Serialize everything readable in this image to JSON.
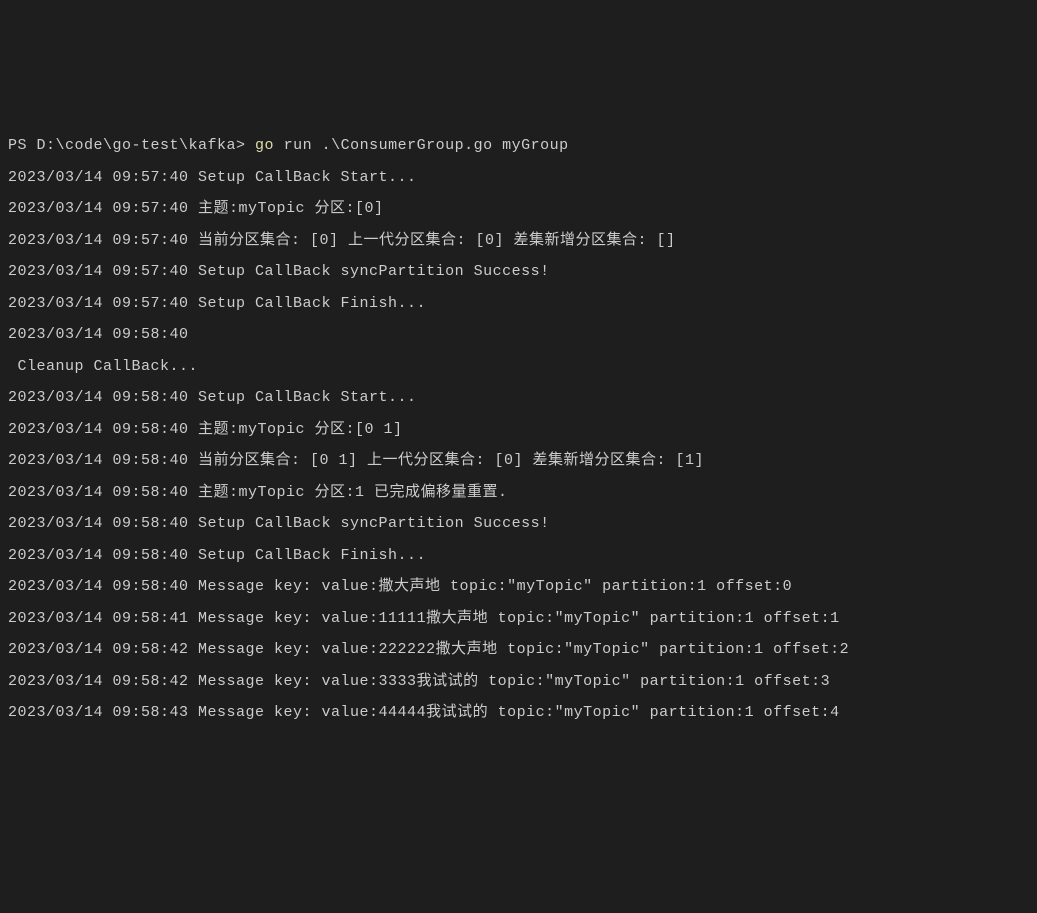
{
  "prompt": {
    "prefix": "PS D:\\code\\go-test\\kafka> ",
    "command": "go",
    "args": " run .\\ConsumerGroup.go myGroup"
  },
  "logs": [
    "2023/03/14 09:57:40 Setup CallBack Start...",
    "2023/03/14 09:57:40 主题:myTopic 分区:[0]",
    "2023/03/14 09:57:40 当前分区集合: [0] 上一代分区集合: [0] 差集新增分区集合: []",
    "2023/03/14 09:57:40 Setup CallBack syncPartition Success!",
    "2023/03/14 09:57:40 Setup CallBack Finish...",
    "2023/03/14 09:58:40",
    " Cleanup CallBack...",
    "2023/03/14 09:58:40 Setup CallBack Start...",
    "2023/03/14 09:58:40 主题:myTopic 分区:[0 1]",
    "2023/03/14 09:58:40 当前分区集合: [0 1] 上一代分区集合: [0] 差集新增分区集合: [1]",
    "2023/03/14 09:58:40 主题:myTopic 分区:1 已完成偏移量重置.",
    "2023/03/14 09:58:40 Setup CallBack syncPartition Success!",
    "2023/03/14 09:58:40 Setup CallBack Finish...",
    "2023/03/14 09:58:40 Message key: value:撒大声地 topic:\"myTopic\" partition:1 offset:0",
    "2023/03/14 09:58:41 Message key: value:11111撒大声地 topic:\"myTopic\" partition:1 offset:1",
    "2023/03/14 09:58:42 Message key: value:222222撒大声地 topic:\"myTopic\" partition:1 offset:2",
    "2023/03/14 09:58:42 Message key: value:3333我试试的 topic:\"myTopic\" partition:1 offset:3",
    "2023/03/14 09:58:43 Message key: value:44444我试试的 topic:\"myTopic\" partition:1 offset:4"
  ]
}
